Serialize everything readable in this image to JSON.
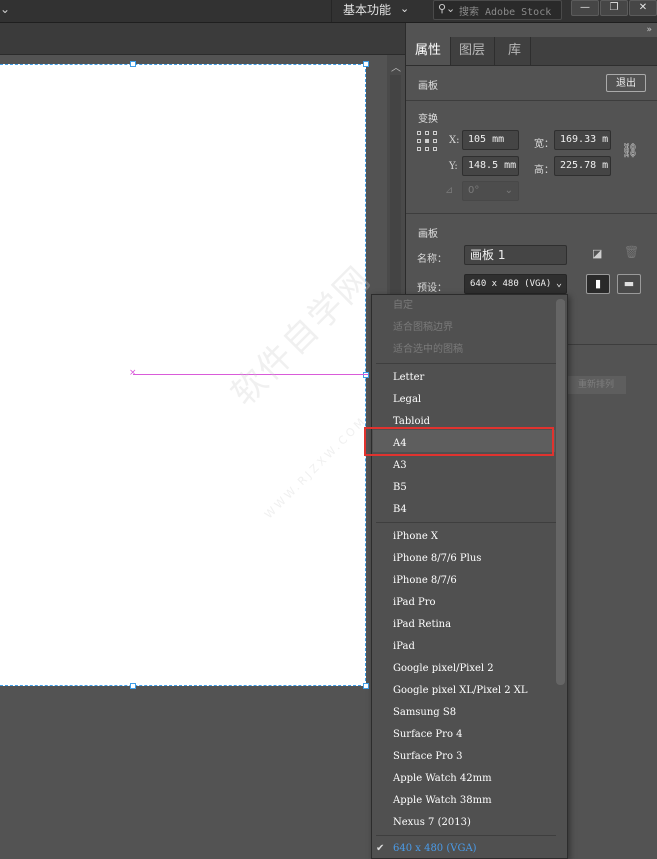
{
  "topbar": {
    "workspace_label": "基本功能",
    "stock_search_placeholder": "搜索 Adobe Stock"
  },
  "panel": {
    "tabs": [
      "属性",
      "图层",
      "库"
    ],
    "artboard_section_title": "画板",
    "exit_label": "退出",
    "transform": {
      "title": "变换",
      "x_label": "X:",
      "x_value": "105 mm",
      "y_label": "Y:",
      "y_value": "148.5 mm",
      "w_label": "宽：",
      "w_value": "169.33 m",
      "h_label": "高：",
      "h_value": "225.78 m",
      "angle_value": "0°"
    },
    "artboard": {
      "title": "画板",
      "name_label": "名称：",
      "name_value": "画板 1",
      "preset_label": "预设：",
      "preset_value": "640 x 480 (VGA)",
      "rearrange_label": "重新排列"
    }
  },
  "dropdown": {
    "disabled_items": [
      "自定",
      "适合图稿边界",
      "适合选中的图稿"
    ],
    "paper_items": [
      "Letter",
      "Legal",
      "Tabloid",
      "A4",
      "A3",
      "B5",
      "B4"
    ],
    "device_items": [
      "iPhone X",
      "iPhone 8/7/6 Plus",
      "iPhone 8/7/6",
      "iPad Pro",
      "iPad Retina",
      "iPad",
      "Google pixel/Pixel 2",
      "Google pixel XL/Pixel 2 XL",
      "Samsung S8",
      "Surface Pro 4",
      "Surface Pro 3",
      "Apple Watch 42mm",
      "Apple Watch 38mm",
      "Nexus 7 (2013)"
    ],
    "selected_item": "640 x 480 (VGA)",
    "highlighted_item": "A4"
  },
  "watermark": {
    "main": "软件自学网",
    "sub": "WWW.RJZXW.COM"
  },
  "colors": {
    "highlight_border": "#e0332f",
    "selected_text": "#4a9be8",
    "artboard_border": "#3f9ee8",
    "guide": "#d95bd9"
  }
}
